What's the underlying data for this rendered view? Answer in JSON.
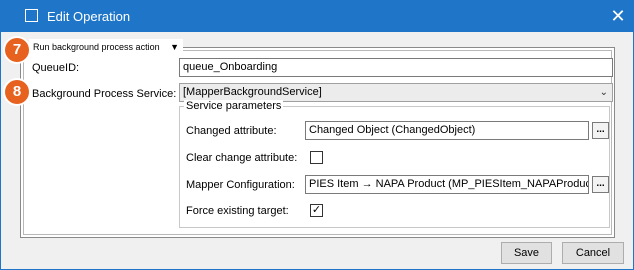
{
  "window": {
    "title": "Edit Operation",
    "close_glyph": "✕",
    "title_icon": "window-icon"
  },
  "section": {
    "header": "Run background process action",
    "toggle_glyph": "▼"
  },
  "badges": {
    "b1": "7",
    "b2": "8"
  },
  "fields": {
    "queue_label": "QueueID:",
    "queue_value": "queue_Onboarding",
    "service_label": "Background Process Service:",
    "service_value": "[MapperBackgroundService]"
  },
  "params": {
    "legend": "Service parameters",
    "changed_attr_label": "Changed attribute:",
    "changed_attr_value": "Changed Object (ChangedObject)",
    "clear_change_label": "Clear change attribute:",
    "clear_change_checked": false,
    "mapper_label": "Mapper Configuration:",
    "mapper_value": "PIES Item → NAPA Product (MP_PIESItem_NAPAProduct)",
    "force_label": "Force existing target:",
    "force_checked": true,
    "ellipsis": "..."
  },
  "buttons": {
    "save": "Save",
    "cancel": "Cancel"
  },
  "colors": {
    "titlebar": "#1f76c9",
    "badge": "#e7611f"
  }
}
